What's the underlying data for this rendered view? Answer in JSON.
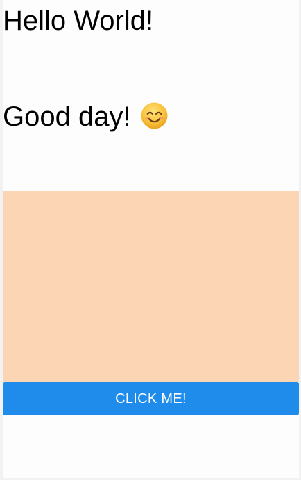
{
  "headings": {
    "first": "Hello World!",
    "second": "Good day!"
  },
  "emoji": {
    "icon": "smiling-face-icon",
    "color": "#f6b62a"
  },
  "content_box": {
    "color": "#fcd6b4"
  },
  "button": {
    "label": "CLICK ME!",
    "color": "#1f8ceb",
    "text_color": "#ffffff"
  }
}
